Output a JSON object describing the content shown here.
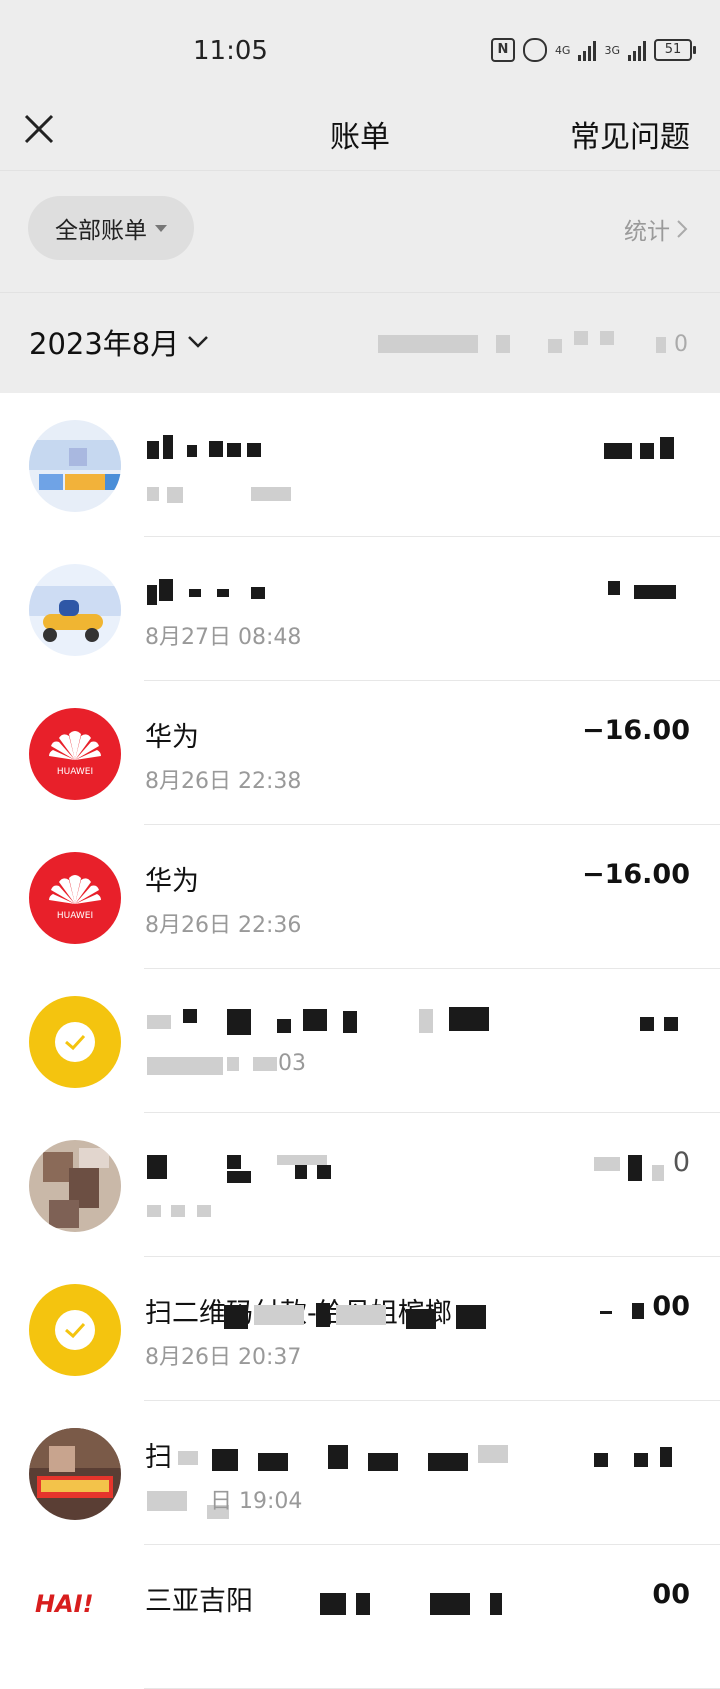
{
  "status_bar": {
    "time": "11:05",
    "signal_1": "4G",
    "signal_2": "3G",
    "battery": "51"
  },
  "nav": {
    "title": "账单",
    "faq": "常见问题"
  },
  "filter": {
    "label": "全部账单",
    "stats": "统计"
  },
  "month": {
    "label": "2023年8月",
    "summary": "0"
  },
  "transactions": [
    {
      "title": "",
      "time": "",
      "amount": "",
      "avatar": "blurred-image-avatar"
    },
    {
      "title": "",
      "time": "8月27日 08:48",
      "amount": "",
      "avatar": "scooter-delivery-avatar"
    },
    {
      "title": "华为",
      "time": "8月26日 22:38",
      "amount": "−16.00",
      "avatar": "huawei-logo",
      "avatar_color": "#e8202a"
    },
    {
      "title": "华为",
      "time": "8月26日 22:36",
      "amount": "−16.00",
      "avatar": "huawei-logo",
      "avatar_color": "#e8202a"
    },
    {
      "title": "",
      "time": "03",
      "amount": "",
      "avatar": "yellow-money-bag-icon",
      "avatar_color": "#f4c40f"
    },
    {
      "title": "",
      "time": "",
      "amount": "0",
      "avatar": "blurred-photo-avatar"
    },
    {
      "title": "扫二维码付款-给丹姐槟榔",
      "time": "8月26日 20:37",
      "amount": "00",
      "avatar": "yellow-money-bag-icon",
      "avatar_color": "#f4c40f"
    },
    {
      "title": "扫",
      "time": "日 19:04",
      "amount": "",
      "avatar": "shop-photo-avatar"
    },
    {
      "title": "三亚吉阳",
      "time": "",
      "amount": "00",
      "avatar": "hai-logo"
    }
  ]
}
